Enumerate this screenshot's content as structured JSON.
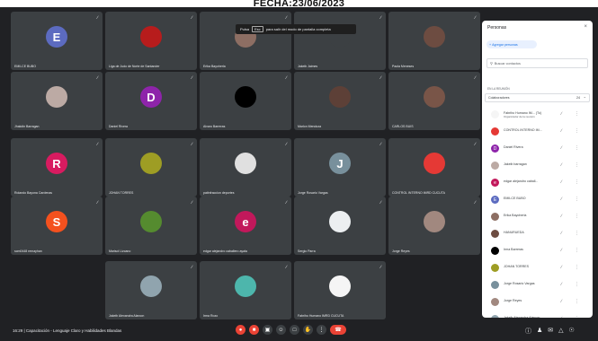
{
  "header": {
    "fecha": "FECHA:23/06/2023"
  },
  "toast": {
    "pre": "Pulsa",
    "key": "Esc",
    "post": "para salir del modo de pantalla completa"
  },
  "colors": {
    "bg": "#202124",
    "tile": "#3c4043",
    "red": "#ea4335",
    "blue": "#1a73e8"
  },
  "tiles": [
    {
      "name": "EMILCE BUBO",
      "initial": "E",
      "color": "#5c6bc0"
    },
    {
      "name": "Liga de Judo de Norte de Santander",
      "initial": "",
      "color": "#b71c1c"
    },
    {
      "name": "Erika Bayoherla",
      "initial": "",
      "color": "#8d6e63"
    },
    {
      "name": "Jakeib Jaimes",
      "initial": "",
      "color": "#3c4043"
    },
    {
      "name": "Paola Meneses",
      "initial": "",
      "color": "#6d4c41"
    },
    {
      "name": "Jhakdin Barragan",
      "initial": "",
      "color": "#bcaaa4"
    },
    {
      "name": "Daniel Rivera",
      "initial": "D",
      "color": "#8e24aa"
    },
    {
      "name": "Alvaro Barreras",
      "initial": "",
      "color": "#000000"
    },
    {
      "name": "Marlon Mendoza",
      "initial": "",
      "color": "#5d4037"
    },
    {
      "name": "CARLOS BUIS",
      "initial": "",
      "color": "#795548"
    },
    {
      "name": "Rolando Bayona Cardenas",
      "initial": "R",
      "color": "#d81b60"
    },
    {
      "name": "JOHAN TORRES",
      "initial": "",
      "color": "#9e9d24"
    },
    {
      "name": "patinfraccion deportes",
      "initial": "",
      "color": "#e0e0e0"
    },
    {
      "name": "Jorge Rosario Vargas",
      "initial": "J",
      "color": "#78909c"
    },
    {
      "name": "CONTROL INTERNO IMRD CUCUTA",
      "initial": "",
      "color": "#e53935"
    },
    {
      "name": "scm0448 remayhan",
      "initial": "S",
      "color": "#f4511e"
    },
    {
      "name": "Marisol Lizcano",
      "initial": "",
      "color": "#558b2f"
    },
    {
      "name": "edgar alejandro caballero ayala",
      "initial": "e",
      "color": "#c2185b"
    },
    {
      "name": "Sergio Parra",
      "initial": "",
      "color": "#eceff1"
    },
    {
      "name": "Jorge Reyes",
      "initial": "",
      "color": "#a1887f"
    },
    {
      "name": "Jakeib Alexandra Alarcon",
      "initial": "",
      "color": "#90a4ae"
    },
    {
      "name": "Irma Rozo",
      "initial": "",
      "color": "#4db6ac"
    },
    {
      "name": "Fabriho Humano IMRD CUCUTA",
      "initial": "",
      "color": "#f5f5f5"
    }
  ],
  "bottom": {
    "meeting_info": "16:29  |  Capacitación - Lenguaje Claro y Habilidades Blandas"
  },
  "panel": {
    "title": "Personas",
    "close": "×",
    "add_label": "Agregar personas",
    "search_placeholder": "Buscar contactos",
    "section_label": "EN LA REUNIÓN",
    "group_label": "Colaboradores",
    "group_count": "24",
    "people": [
      {
        "name": "Fabriho Humano IM... (Tú)",
        "sub": "Organizador de la reunión",
        "initial": "",
        "color": "#f5f5f5"
      },
      {
        "name": "CONTROL INTERNO IM...",
        "sub": "",
        "initial": "",
        "color": "#e53935"
      },
      {
        "name": "Daniel Rivera",
        "sub": "",
        "initial": "D",
        "color": "#8e24aa"
      },
      {
        "name": "Jakeib barragan",
        "sub": "",
        "initial": "",
        "color": "#bcaaa4"
      },
      {
        "name": "edgar alejandro caball...",
        "sub": "",
        "initial": "e",
        "color": "#c2185b"
      },
      {
        "name": "EMILCE BUBO",
        "sub": "",
        "initial": "E",
        "color": "#5c6bc0"
      },
      {
        "name": "Erika Bayoherla",
        "sub": "",
        "initial": "",
        "color": "#8d6e63"
      },
      {
        "name": "HANURUEDA",
        "sub": "",
        "initial": "",
        "color": "#6d4c41"
      },
      {
        "name": "Irma Barreras",
        "sub": "",
        "initial": "",
        "color": "#000000"
      },
      {
        "name": "JOHAN TORRES",
        "sub": "",
        "initial": "",
        "color": "#9e9d24"
      },
      {
        "name": "Jorge Rosario Vargas",
        "sub": "",
        "initial": "",
        "color": "#78909c"
      },
      {
        "name": "Jorge Reyes",
        "sub": "",
        "initial": "",
        "color": "#a1887f"
      },
      {
        "name": "Jakeib Alexandra Alarcon",
        "sub": "",
        "initial": "",
        "color": "#90a4ae"
      }
    ]
  }
}
